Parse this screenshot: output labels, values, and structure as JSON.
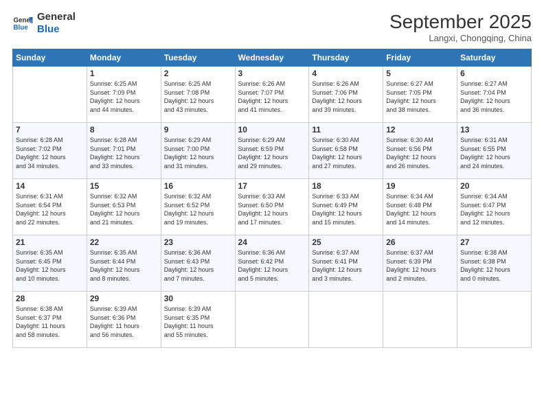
{
  "header": {
    "logo_line1": "General",
    "logo_line2": "Blue",
    "month": "September 2025",
    "location": "Langxi, Chongqing, China"
  },
  "weekdays": [
    "Sunday",
    "Monday",
    "Tuesday",
    "Wednesday",
    "Thursday",
    "Friday",
    "Saturday"
  ],
  "weeks": [
    [
      {
        "day": "",
        "info": ""
      },
      {
        "day": "1",
        "info": "Sunrise: 6:25 AM\nSunset: 7:09 PM\nDaylight: 12 hours\nand 44 minutes."
      },
      {
        "day": "2",
        "info": "Sunrise: 6:25 AM\nSunset: 7:08 PM\nDaylight: 12 hours\nand 43 minutes."
      },
      {
        "day": "3",
        "info": "Sunrise: 6:26 AM\nSunset: 7:07 PM\nDaylight: 12 hours\nand 41 minutes."
      },
      {
        "day": "4",
        "info": "Sunrise: 6:26 AM\nSunset: 7:06 PM\nDaylight: 12 hours\nand 39 minutes."
      },
      {
        "day": "5",
        "info": "Sunrise: 6:27 AM\nSunset: 7:05 PM\nDaylight: 12 hours\nand 38 minutes."
      },
      {
        "day": "6",
        "info": "Sunrise: 6:27 AM\nSunset: 7:04 PM\nDaylight: 12 hours\nand 36 minutes."
      }
    ],
    [
      {
        "day": "7",
        "info": "Sunrise: 6:28 AM\nSunset: 7:02 PM\nDaylight: 12 hours\nand 34 minutes."
      },
      {
        "day": "8",
        "info": "Sunrise: 6:28 AM\nSunset: 7:01 PM\nDaylight: 12 hours\nand 33 minutes."
      },
      {
        "day": "9",
        "info": "Sunrise: 6:29 AM\nSunset: 7:00 PM\nDaylight: 12 hours\nand 31 minutes."
      },
      {
        "day": "10",
        "info": "Sunrise: 6:29 AM\nSunset: 6:59 PM\nDaylight: 12 hours\nand 29 minutes."
      },
      {
        "day": "11",
        "info": "Sunrise: 6:30 AM\nSunset: 6:58 PM\nDaylight: 12 hours\nand 27 minutes."
      },
      {
        "day": "12",
        "info": "Sunrise: 6:30 AM\nSunset: 6:56 PM\nDaylight: 12 hours\nand 26 minutes."
      },
      {
        "day": "13",
        "info": "Sunrise: 6:31 AM\nSunset: 6:55 PM\nDaylight: 12 hours\nand 24 minutes."
      }
    ],
    [
      {
        "day": "14",
        "info": "Sunrise: 6:31 AM\nSunset: 6:54 PM\nDaylight: 12 hours\nand 22 minutes."
      },
      {
        "day": "15",
        "info": "Sunrise: 6:32 AM\nSunset: 6:53 PM\nDaylight: 12 hours\nand 21 minutes."
      },
      {
        "day": "16",
        "info": "Sunrise: 6:32 AM\nSunset: 6:52 PM\nDaylight: 12 hours\nand 19 minutes."
      },
      {
        "day": "17",
        "info": "Sunrise: 6:33 AM\nSunset: 6:50 PM\nDaylight: 12 hours\nand 17 minutes."
      },
      {
        "day": "18",
        "info": "Sunrise: 6:33 AM\nSunset: 6:49 PM\nDaylight: 12 hours\nand 15 minutes."
      },
      {
        "day": "19",
        "info": "Sunrise: 6:34 AM\nSunset: 6:48 PM\nDaylight: 12 hours\nand 14 minutes."
      },
      {
        "day": "20",
        "info": "Sunrise: 6:34 AM\nSunset: 6:47 PM\nDaylight: 12 hours\nand 12 minutes."
      }
    ],
    [
      {
        "day": "21",
        "info": "Sunrise: 6:35 AM\nSunset: 6:45 PM\nDaylight: 12 hours\nand 10 minutes."
      },
      {
        "day": "22",
        "info": "Sunrise: 6:35 AM\nSunset: 6:44 PM\nDaylight: 12 hours\nand 8 minutes."
      },
      {
        "day": "23",
        "info": "Sunrise: 6:36 AM\nSunset: 6:43 PM\nDaylight: 12 hours\nand 7 minutes."
      },
      {
        "day": "24",
        "info": "Sunrise: 6:36 AM\nSunset: 6:42 PM\nDaylight: 12 hours\nand 5 minutes."
      },
      {
        "day": "25",
        "info": "Sunrise: 6:37 AM\nSunset: 6:41 PM\nDaylight: 12 hours\nand 3 minutes."
      },
      {
        "day": "26",
        "info": "Sunrise: 6:37 AM\nSunset: 6:39 PM\nDaylight: 12 hours\nand 2 minutes."
      },
      {
        "day": "27",
        "info": "Sunrise: 6:38 AM\nSunset: 6:38 PM\nDaylight: 12 hours\nand 0 minutes."
      }
    ],
    [
      {
        "day": "28",
        "info": "Sunrise: 6:38 AM\nSunset: 6:37 PM\nDaylight: 11 hours\nand 58 minutes."
      },
      {
        "day": "29",
        "info": "Sunrise: 6:39 AM\nSunset: 6:36 PM\nDaylight: 11 hours\nand 56 minutes."
      },
      {
        "day": "30",
        "info": "Sunrise: 6:39 AM\nSunset: 6:35 PM\nDaylight: 11 hours\nand 55 minutes."
      },
      {
        "day": "",
        "info": ""
      },
      {
        "day": "",
        "info": ""
      },
      {
        "day": "",
        "info": ""
      },
      {
        "day": "",
        "info": ""
      }
    ]
  ]
}
